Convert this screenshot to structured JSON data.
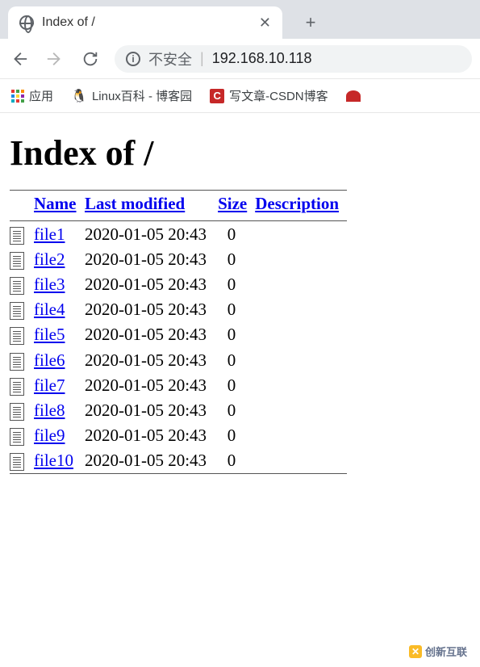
{
  "browser": {
    "tab_title": "Index of /",
    "security_label": "不安全",
    "url": "192.168.10.118",
    "apps_label": "应用",
    "bookmarks": [
      {
        "label": "Linux百科 - 博客园",
        "icon": "linux"
      },
      {
        "label": "写文章-CSDN博客",
        "icon": "c"
      }
    ]
  },
  "page": {
    "heading": "Index of /",
    "columns": {
      "name": "Name",
      "modified": "Last modified",
      "size": "Size",
      "description": "Description"
    },
    "files": [
      {
        "name": "file1",
        "modified": "2020-01-05 20:43",
        "size": "0"
      },
      {
        "name": "file2",
        "modified": "2020-01-05 20:43",
        "size": "0"
      },
      {
        "name": "file3",
        "modified": "2020-01-05 20:43",
        "size": "0"
      },
      {
        "name": "file4",
        "modified": "2020-01-05 20:43",
        "size": "0"
      },
      {
        "name": "file5",
        "modified": "2020-01-05 20:43",
        "size": "0"
      },
      {
        "name": "file6",
        "modified": "2020-01-05 20:43",
        "size": "0"
      },
      {
        "name": "file7",
        "modified": "2020-01-05 20:43",
        "size": "0"
      },
      {
        "name": "file8",
        "modified": "2020-01-05 20:43",
        "size": "0"
      },
      {
        "name": "file9",
        "modified": "2020-01-05 20:43",
        "size": "0"
      },
      {
        "name": "file10",
        "modified": "2020-01-05 20:43",
        "size": "0"
      }
    ]
  },
  "watermark": "创新互联"
}
